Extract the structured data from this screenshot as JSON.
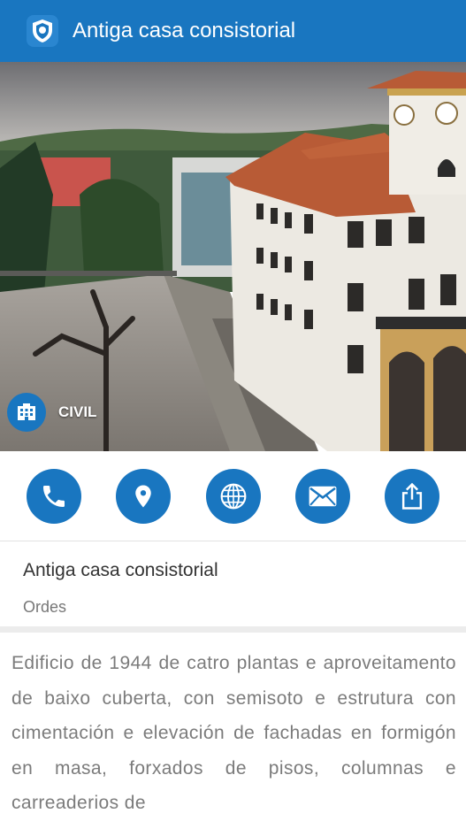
{
  "appbar": {
    "title": "Antiga casa consistorial",
    "logo_icon": "shield-logo-icon",
    "color": "#1976c0"
  },
  "hero": {
    "category_label": "CIVIL",
    "category_icon": "building-icon"
  },
  "actions": [
    {
      "name": "call-button",
      "icon": "phone-icon"
    },
    {
      "name": "map-button",
      "icon": "location-pin-icon"
    },
    {
      "name": "web-button",
      "icon": "globe-icon"
    },
    {
      "name": "email-button",
      "icon": "envelope-icon"
    },
    {
      "name": "share-button",
      "icon": "share-icon"
    }
  ],
  "info": {
    "name": "Antiga casa consistorial",
    "town": "Ordes"
  },
  "description": "Edificio de 1944 de catro plantas e aproveitamento de baixo cuberta, con semisoto e estrutura con cimentación e elevación de fachadas en formigón en masa, forxados de pisos, columnas e carreaderios de"
}
